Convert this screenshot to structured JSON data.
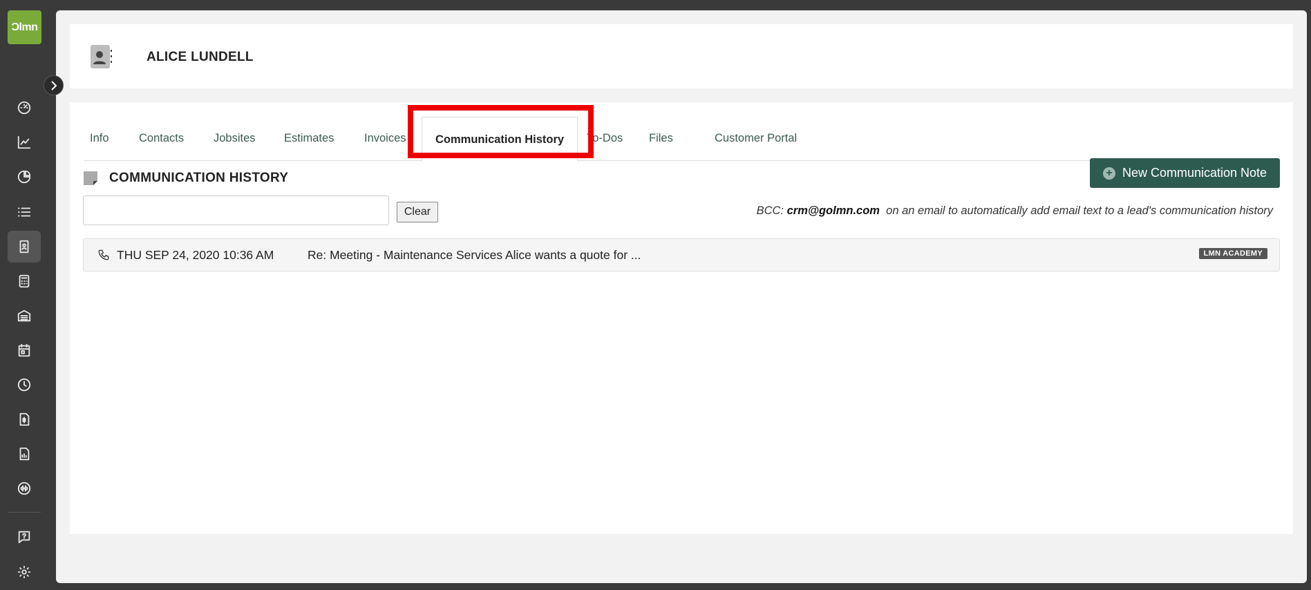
{
  "app": {
    "logo_text": "Ɔlmn"
  },
  "sidebar": {
    "items": [
      {
        "name": "dashboard-icon"
      },
      {
        "name": "chart-line-icon"
      },
      {
        "name": "pie-chart-icon"
      },
      {
        "name": "list-icon"
      },
      {
        "name": "contact-icon",
        "active": true
      },
      {
        "name": "calculator-icon"
      },
      {
        "name": "warehouse-icon"
      },
      {
        "name": "calendar-icon"
      },
      {
        "name": "clock-icon"
      },
      {
        "name": "invoice-icon"
      },
      {
        "name": "report-icon"
      },
      {
        "name": "quickbooks-icon"
      },
      {
        "name": "help-icon"
      },
      {
        "name": "settings-icon"
      }
    ]
  },
  "header": {
    "title": "ALICE LUNDELL"
  },
  "tabs": [
    {
      "label": "Info"
    },
    {
      "label": "Contacts"
    },
    {
      "label": "Jobsites"
    },
    {
      "label": "Estimates"
    },
    {
      "label": "Invoices"
    },
    {
      "label": "Communication History",
      "active": true
    },
    {
      "label": "To-Dos"
    },
    {
      "label": "Files"
    },
    {
      "label": "Customer Portal"
    }
  ],
  "section": {
    "title": "COMMUNICATION HISTORY",
    "new_button_label": "New Communication Note",
    "search_value": "",
    "clear_label": "Clear",
    "bcc_prefix": "BCC:",
    "bcc_email": "crm@golmn.com",
    "bcc_suffix": "on an email to automatically add email text to a lead's communication history"
  },
  "history": [
    {
      "type": "phone-icon",
      "date": "THU SEP 24, 2020 10:36 AM",
      "subject": "Re: Meeting - Maintenance Services Alice wants a quote for ...",
      "badge": "LMN ACADEMY"
    }
  ],
  "colors": {
    "accent": "#2e5b50",
    "logo": "#7aab3a",
    "highlight": "#ee0000",
    "tab_text": "#3d5a4f"
  }
}
